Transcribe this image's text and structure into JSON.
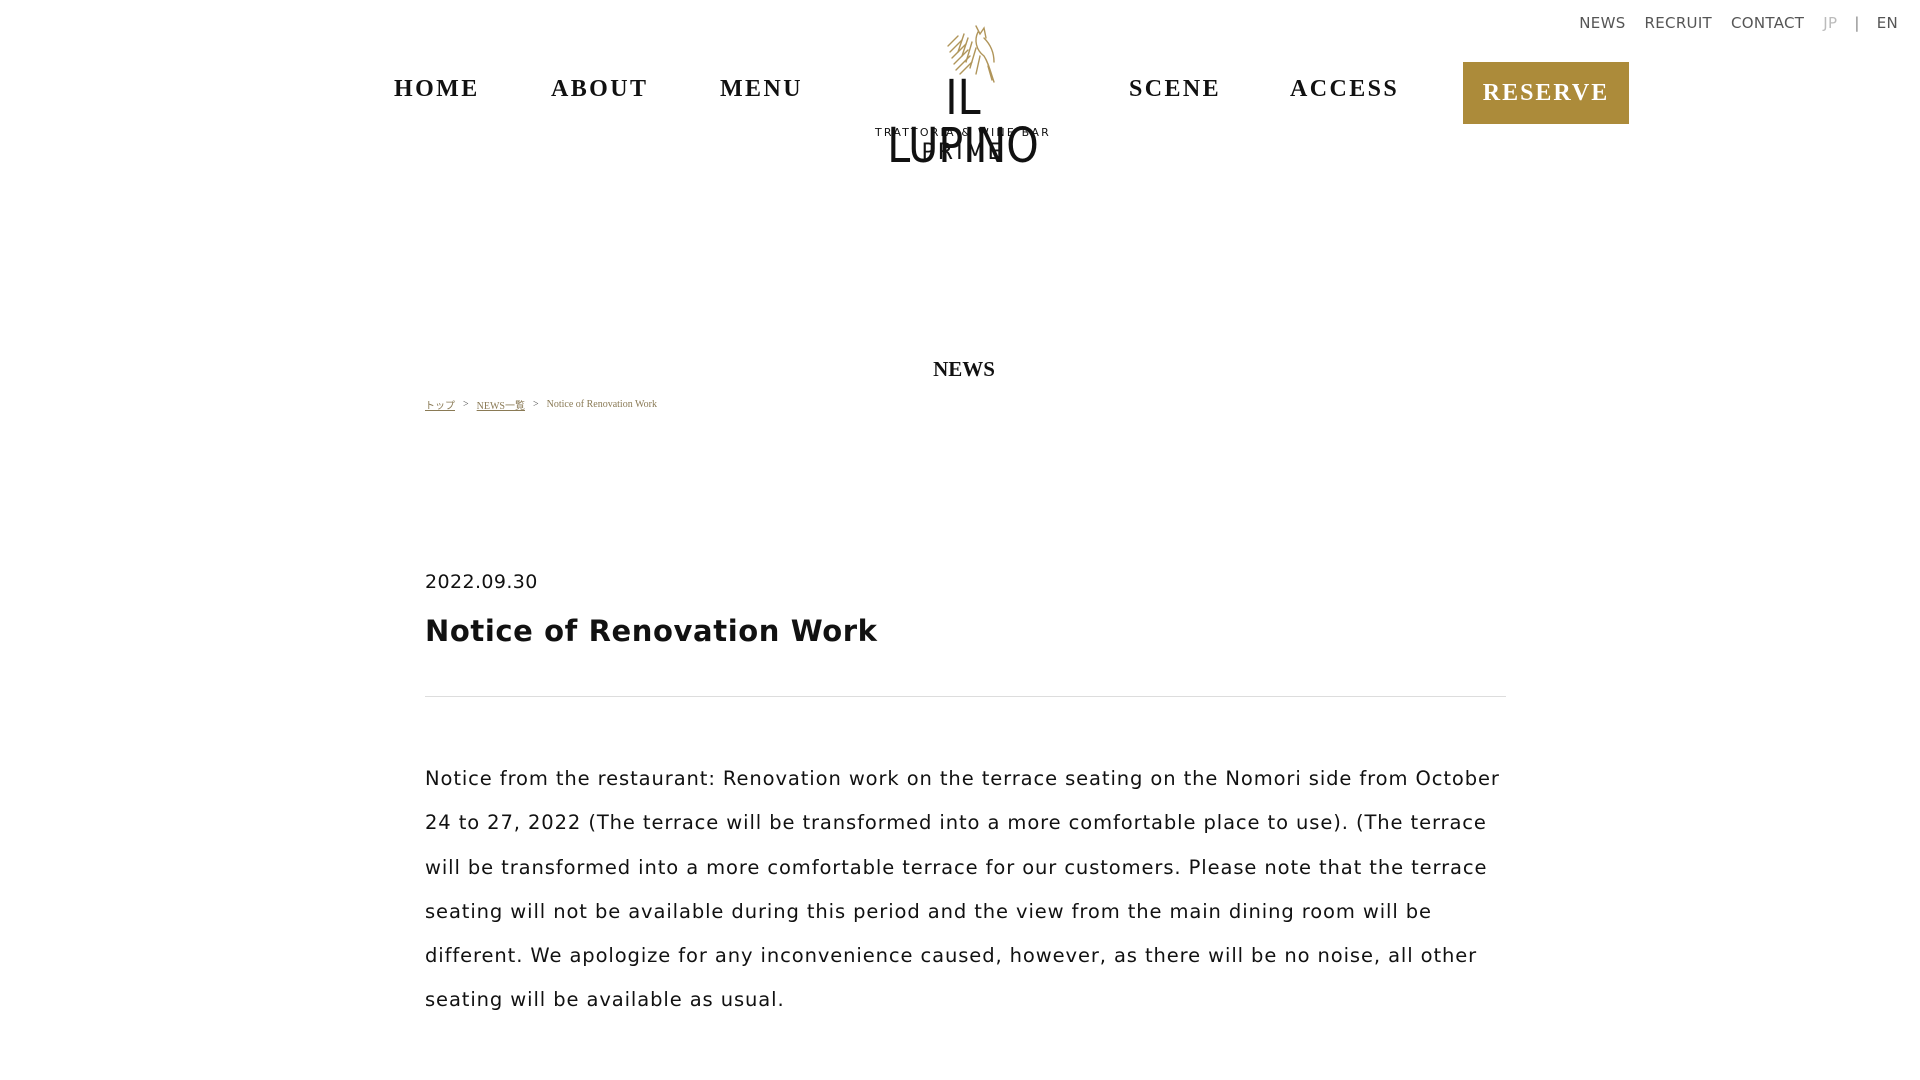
{
  "util_nav": {
    "news": "NEWS",
    "recruit": "RECRUIT",
    "contact": "CONTACT",
    "lang_jp": "JP",
    "lang_sep": "|",
    "lang_en": "EN"
  },
  "main_nav": {
    "home": "HOME",
    "about": "ABOUT",
    "menu": "MENU",
    "scene": "SCENE",
    "access": "ACCESS",
    "reserve": "RESERVE"
  },
  "logo": {
    "main": "IL LUPINO",
    "sub": "TRATTORIA & WINE BAR",
    "prime": "PRIME"
  },
  "page": {
    "heading": "NEWS"
  },
  "breadcrumb": {
    "home": "トップ",
    "sep1": ">",
    "list": "NEWS一覧",
    "sep2": ">",
    "current": "Notice of Renovation Work"
  },
  "article": {
    "date": "2022.09.30",
    "title": "Notice of Renovation Work",
    "body": "Notice from the restaurant: Renovation work on the terrace seating on the Nomori side from October 24 to 27, 2022 (The terrace will be transformed into a more comfortable place to use). (The terrace will be transformed into a more comfortable terrace for our customers. Please note that the terrace seating will not be available during this period and the view from the main dining room will be different. We apologize for any inconvenience caused, however, as there will be no noise, all other seating will be available as usual."
  },
  "colors": {
    "accent": "#ac8b3a",
    "breadcrumb": "#8a7a55",
    "text": "#111111"
  },
  "icons": {
    "logo_mark": "wolf-icon"
  }
}
